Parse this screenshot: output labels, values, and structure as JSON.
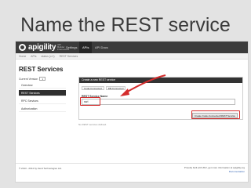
{
  "slide": {
    "title": "Name the REST service"
  },
  "app": {
    "brand": "apigility",
    "brand_tagline": "API Builder Framework",
    "nav": [
      "Settings",
      "APIs",
      "API Docs"
    ],
    "breadcrumb": [
      "Home",
      "APIs",
      "status (v.1)",
      "REST Services"
    ]
  },
  "page": {
    "title": "REST Services",
    "current_version_label": "Current Version",
    "current_version_value": "1",
    "sidebar": [
      "Overview",
      "REST Services",
      "RPC Services",
      "Authorization"
    ]
  },
  "panel": {
    "header": "Create a new REST service",
    "tabs": [
      "Code-Connected",
      "DB-Connected"
    ],
    "field_label": "REST Service Name",
    "field_value": "ssrl",
    "button_label": "Create Code-Connected REST Service"
  },
  "empty_message": "No REST services defined.",
  "footer": {
    "copyright": "© 2013 - 2014 by Zend Technologies Ltd.",
    "right_line1": "Proudly built with ZF2, get more information at apigility.org",
    "right_line2": "Documentation"
  },
  "colors": {
    "navbar": "#3b3b3b",
    "highlight": "#d42c2c",
    "active": "#2f2f2f"
  }
}
